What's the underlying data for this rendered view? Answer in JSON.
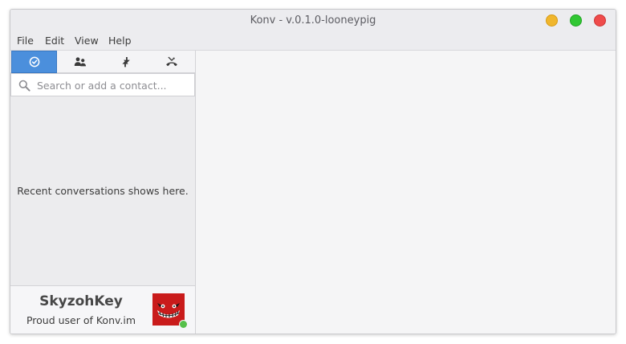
{
  "window": {
    "title": "Konv - v.0.1.0-looneypig",
    "controls": {
      "minimize_color": "#f0b62d",
      "maximize_color": "#31c733",
      "close_color": "#ef4b4b"
    }
  },
  "menubar": {
    "items": [
      {
        "label": "File"
      },
      {
        "label": "Edit"
      },
      {
        "label": "View"
      },
      {
        "label": "Help"
      }
    ]
  },
  "sidebar": {
    "tabs": [
      {
        "icon": "clock-icon",
        "active": true
      },
      {
        "icon": "contacts-icon",
        "active": false
      },
      {
        "icon": "transfers-icon",
        "active": false
      },
      {
        "icon": "calls-icon",
        "active": false
      }
    ],
    "search": {
      "placeholder": "Search or add a contact...",
      "value": ""
    },
    "empty_message": "Recent conversations shows here.",
    "profile": {
      "name": "SkyzohKey",
      "status_message": "Proud user of Konv.im",
      "presence": "online",
      "presence_color": "#56c04a"
    }
  },
  "accent_color": "#4b8fdc"
}
